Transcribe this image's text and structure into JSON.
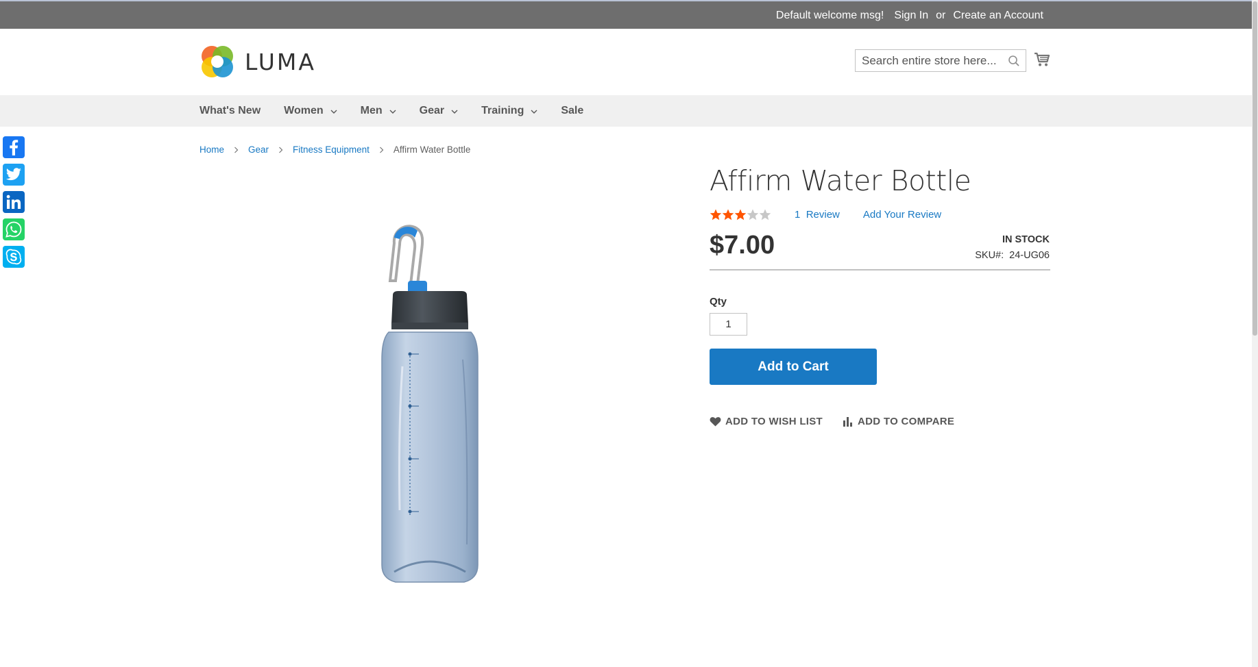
{
  "topbar": {
    "welcome": "Default welcome msg!",
    "sign_in": "Sign In",
    "or": "or",
    "create_account": "Create an Account"
  },
  "header": {
    "logo_text": "LUMA",
    "search_placeholder": "Search entire store here...",
    "search_icon": "search-icon",
    "cart_icon": "cart-icon"
  },
  "nav": {
    "items": [
      {
        "label": "What's New",
        "has_dropdown": false
      },
      {
        "label": "Women",
        "has_dropdown": true
      },
      {
        "label": "Men",
        "has_dropdown": true
      },
      {
        "label": "Gear",
        "has_dropdown": true
      },
      {
        "label": "Training",
        "has_dropdown": true
      },
      {
        "label": "Sale",
        "has_dropdown": false
      }
    ]
  },
  "social": [
    {
      "name": "facebook-icon",
      "color": "#1877f2"
    },
    {
      "name": "twitter-icon",
      "color": "#1da1f2"
    },
    {
      "name": "linkedin-icon",
      "color": "#0a66c2"
    },
    {
      "name": "whatsapp-icon",
      "color": "#25d366"
    },
    {
      "name": "skype-icon",
      "color": "#00aff0"
    }
  ],
  "breadcrumb": {
    "items": [
      "Home",
      "Gear",
      "Fitness Equipment"
    ],
    "current": "Affirm Water Bottle"
  },
  "product": {
    "title": "Affirm Water Bottle",
    "rating_stars": 3,
    "rating_max": 5,
    "reviews_count": "1",
    "reviews_label": "Review",
    "add_review": "Add Your Review",
    "price": "$7.00",
    "stock": "IN STOCK",
    "sku_label": "SKU#:",
    "sku_value": "24-UG06",
    "qty_label": "Qty",
    "qty_value": "1",
    "add_to_cart": "Add to Cart",
    "wishlist": "ADD TO WISH LIST",
    "compare": "ADD TO COMPARE"
  },
  "colors": {
    "accent": "#1979c3",
    "star_filled": "#ff5501",
    "star_empty": "#c7c7c7",
    "topbar_bg": "#6e6e6e",
    "nav_bg": "#f0f0f0"
  }
}
